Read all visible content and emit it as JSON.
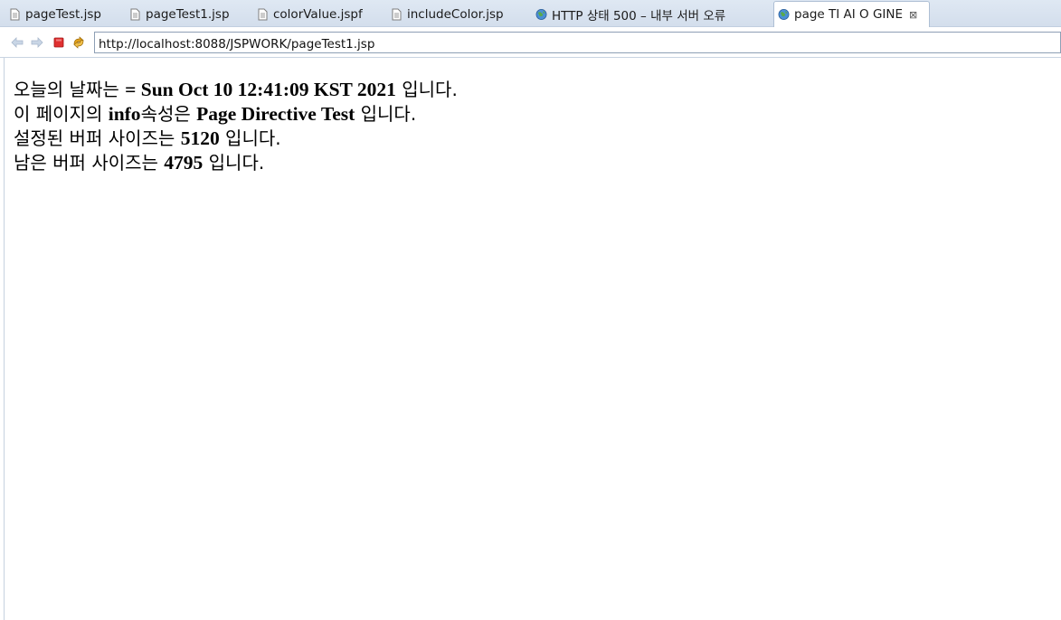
{
  "tabs": [
    {
      "label": "pageTest.jsp",
      "icon": "file-icon",
      "active": false
    },
    {
      "label": "pageTest1.jsp",
      "icon": "file-icon",
      "active": false
    },
    {
      "label": "colorValue.jspf",
      "icon": "file-icon",
      "active": false
    },
    {
      "label": "includeColor.jsp",
      "icon": "file-icon",
      "active": false
    },
    {
      "label": "HTTP 상태 500 – 내부 서버 오류",
      "icon": "globe-icon",
      "active": false
    },
    {
      "label": "page TI AI O GINE",
      "icon": "globe-icon",
      "active": true,
      "close": "⊠"
    }
  ],
  "toolbar": {
    "url": "http://localhost:8088/JSPWORK/pageTest1.jsp",
    "buttons": [
      "back-icon",
      "forward-icon",
      "stop-icon",
      "refresh-icon"
    ]
  },
  "content": {
    "line1": {
      "prefix": "오늘의 날짜는 ",
      "value": "= Sun Oct 10 12:41:09 KST 2021",
      "suffix": " 입니다."
    },
    "line2": {
      "prefix": "이 페이지의 ",
      "value1": "info",
      "middle": "속성은 ",
      "value2": "Page Directive Test",
      "suffix": " 입니다."
    },
    "line3": {
      "prefix": "설정된 버퍼 사이즈는 ",
      "value": "5120",
      "suffix": " 입니다."
    },
    "line4": {
      "prefix": "남은 버퍼 사이즈는 ",
      "value": "4795",
      "suffix": " 입니다."
    }
  },
  "colors": {
    "tabstrip": "#d3deec",
    "stop": "#e03030",
    "refresh": "#d99a1a"
  }
}
